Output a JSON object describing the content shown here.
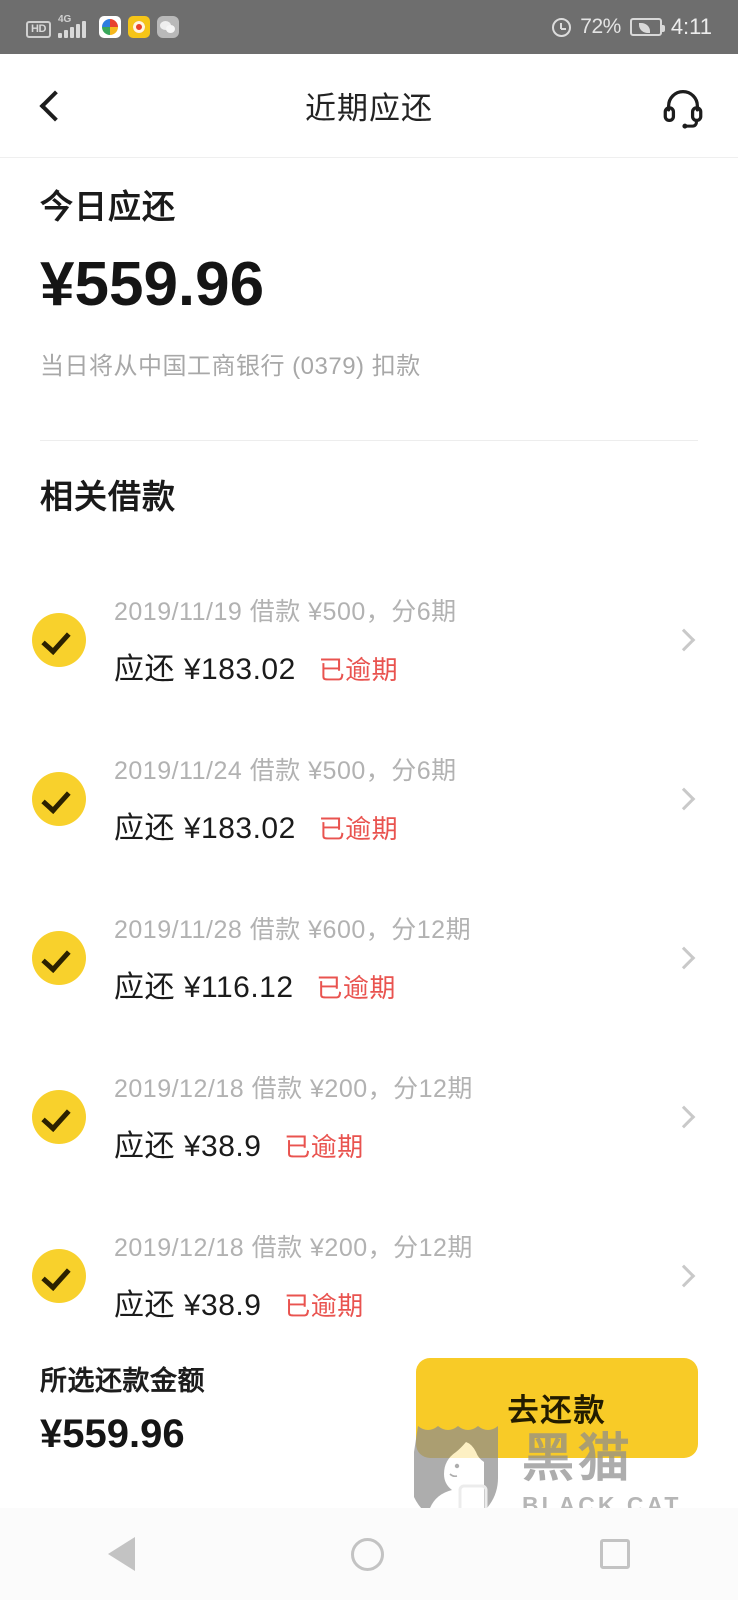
{
  "status_bar": {
    "hd_label": "HD",
    "network_label": "4G",
    "app_icons": [
      "photo-app-icon",
      "weibo-icon",
      "wechat-icon"
    ],
    "alarm_icon": "alarm-clock-icon",
    "battery_percent": "72%",
    "battery_icon": "battery-power-saving-icon",
    "time": "4:11"
  },
  "header": {
    "back_icon": "chevron-left-icon",
    "title": "近期应还",
    "service_icon": "headset-icon"
  },
  "today": {
    "label": "今日应还",
    "amount": "¥559.96",
    "note": "当日将从中国工商银行 (0379) 扣款"
  },
  "loans": {
    "section_title": "相关借款",
    "items": [
      {
        "checked": true,
        "meta": "2019/11/19 借款 ¥500，分6期",
        "due": "应还 ¥183.02",
        "status": "已逾期"
      },
      {
        "checked": true,
        "meta": "2019/11/24 借款 ¥500，分6期",
        "due": "应还 ¥183.02",
        "status": "已逾期"
      },
      {
        "checked": true,
        "meta": "2019/11/28 借款 ¥600，分12期",
        "due": "应还 ¥116.12",
        "status": "已逾期"
      },
      {
        "checked": true,
        "meta": "2019/12/18 借款 ¥200，分12期",
        "due": "应还 ¥38.9",
        "status": "已逾期"
      },
      {
        "checked": true,
        "meta": "2019/12/18 借款 ¥200，分12期",
        "due": "应还 ¥38.9",
        "status": "已逾期"
      }
    ]
  },
  "bottom_bar": {
    "selected_label": "所选还款金额",
    "selected_amount": "¥559.96",
    "pay_button": "去还款"
  },
  "watermark": {
    "cn": "黑猫",
    "en": "BLACK CAT"
  },
  "nav_bar": {
    "back": "nav-back-icon",
    "home": "nav-home-icon",
    "recent": "nav-recent-icon"
  },
  "colors": {
    "accent_yellow": "#f8cb27",
    "check_yellow": "#f8d12c",
    "overdue_red": "#e9534f",
    "status_bar_gray": "#6e6e6e",
    "muted_text": "#b2b2b2"
  }
}
